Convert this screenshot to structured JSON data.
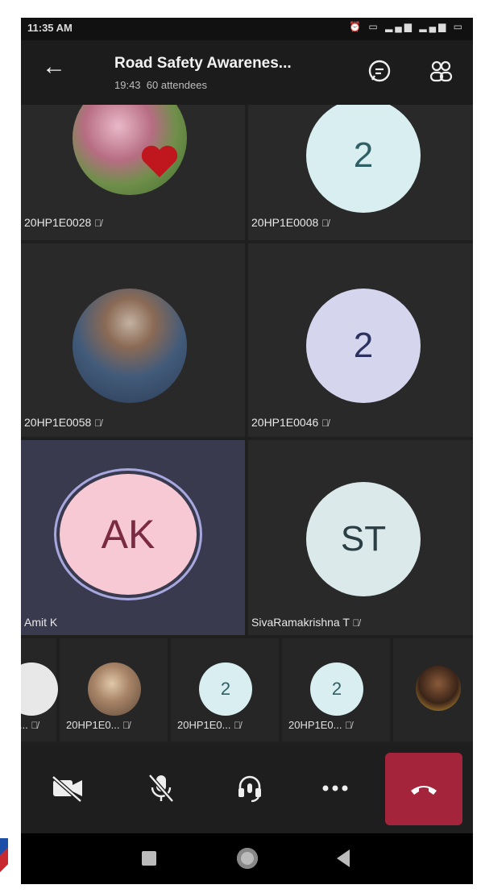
{
  "status": {
    "time": "11:35 AM"
  },
  "header": {
    "title": "Road Safety Awarenes...",
    "duration": "19:43",
    "attendees": "60 attendees"
  },
  "tiles": [
    {
      "name": "20HP1E0028",
      "initials": ""
    },
    {
      "name": "20HP1E0008",
      "initials": "2"
    },
    {
      "name": "20HP1E0058",
      "initials": ""
    },
    {
      "name": "20HP1E0046",
      "initials": "2"
    },
    {
      "name": "Amit K",
      "initials": "AK"
    },
    {
      "name": "SivaRamakrishna T",
      "initials": "ST"
    }
  ],
  "strip": [
    {
      "name": "...",
      "initials": ""
    },
    {
      "name": "20HP1E0...",
      "initials": ""
    },
    {
      "name": "20HP1E0...",
      "initials": "2"
    },
    {
      "name": "20HP1E0...",
      "initials": "2"
    },
    {
      "name": "",
      "initials": ""
    }
  ],
  "colors": {
    "tile_bg": "#292929",
    "active_tile_bg": "#3a3a4e",
    "hangup": "#a4243b",
    "avatar_ak": "#f6c9d4",
    "avatar_st": "#dbe9ea",
    "avatar_lavender": "#d5d5ee",
    "avatar_light": "#d8eef0"
  }
}
